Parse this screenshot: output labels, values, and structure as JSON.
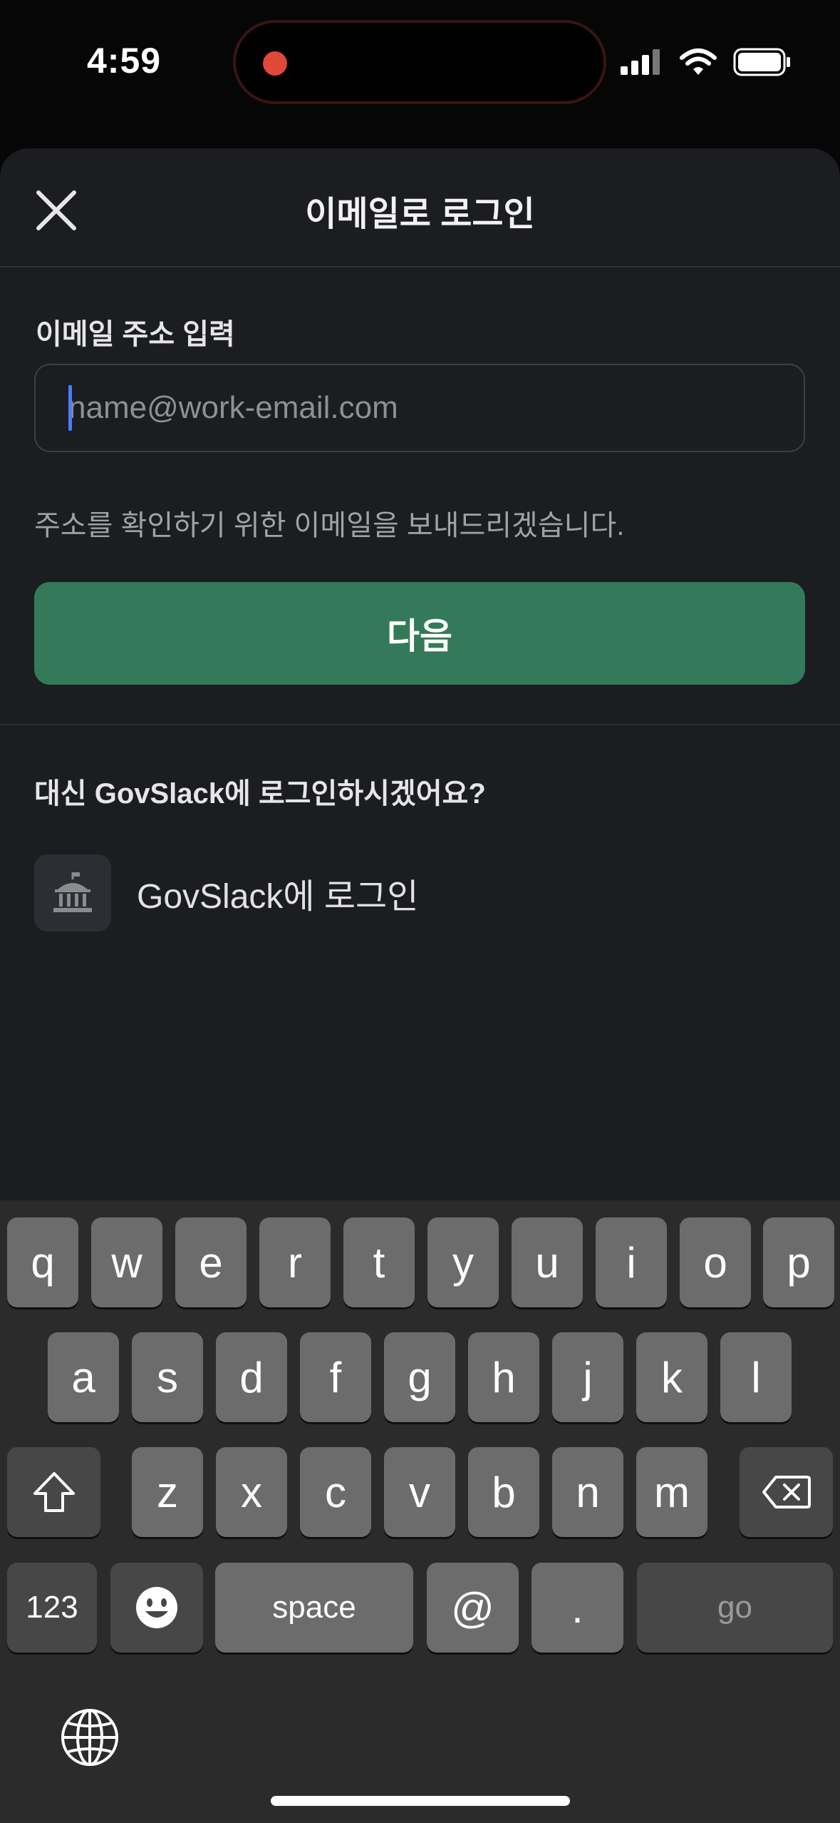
{
  "status_bar": {
    "time": "4:59"
  },
  "header": {
    "title": "이메일로 로그인"
  },
  "form": {
    "label": "이메일 주소 입력",
    "placeholder": "name@work-email.com",
    "value": "",
    "hint": "주소를 확인하기 위한 이메일을 보내드리겠습니다.",
    "next_label": "다음"
  },
  "alt": {
    "question": "대신 GovSlack에 로그인하시겠어요?",
    "govslack_label": "GovSlack에 로그인"
  },
  "keyboard": {
    "row1": [
      "q",
      "w",
      "e",
      "r",
      "t",
      "y",
      "u",
      "i",
      "o",
      "p"
    ],
    "row2": [
      "a",
      "s",
      "d",
      "f",
      "g",
      "h",
      "j",
      "k",
      "l"
    ],
    "row3": [
      "z",
      "x",
      "c",
      "v",
      "b",
      "n",
      "m"
    ],
    "numbers_label": "123",
    "space_label": "space",
    "at_label": "@",
    "period_label": ".",
    "go_label": "go"
  },
  "colors": {
    "accent_button": "#347a5a",
    "caret": "#4d7cf6",
    "recording_dot": "#e0483a"
  }
}
